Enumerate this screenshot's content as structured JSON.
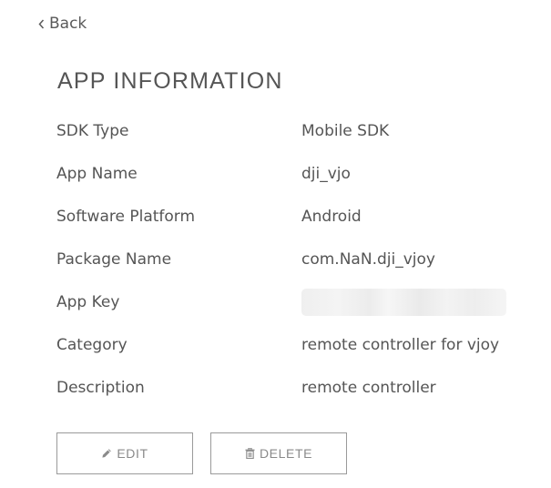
{
  "nav": {
    "back_label": "Back",
    "back_icon": "chevron-left-icon"
  },
  "page": {
    "title": "APP INFORMATION"
  },
  "info": {
    "rows": [
      {
        "label": "SDK Type",
        "value": "Mobile SDK"
      },
      {
        "label": "App Name",
        "value": "dji_vjo"
      },
      {
        "label": "Software Platform",
        "value": "Android"
      },
      {
        "label": "Package Name",
        "value": "com.NaN.dji_vjoy"
      },
      {
        "label": "App Key"
      },
      {
        "label": "Category",
        "value": "remote controller for vjoy"
      },
      {
        "label": "Description",
        "value": "remote controller"
      }
    ]
  },
  "actions": {
    "edit_label": "EDIT",
    "edit_icon": "pencil-icon",
    "delete_label": "DELETE",
    "delete_icon": "trash-icon"
  },
  "colors": {
    "text": "#555555",
    "button_text": "#8a8a8a",
    "button_border": "#9a9a9a",
    "masked_value": "#efefef"
  }
}
